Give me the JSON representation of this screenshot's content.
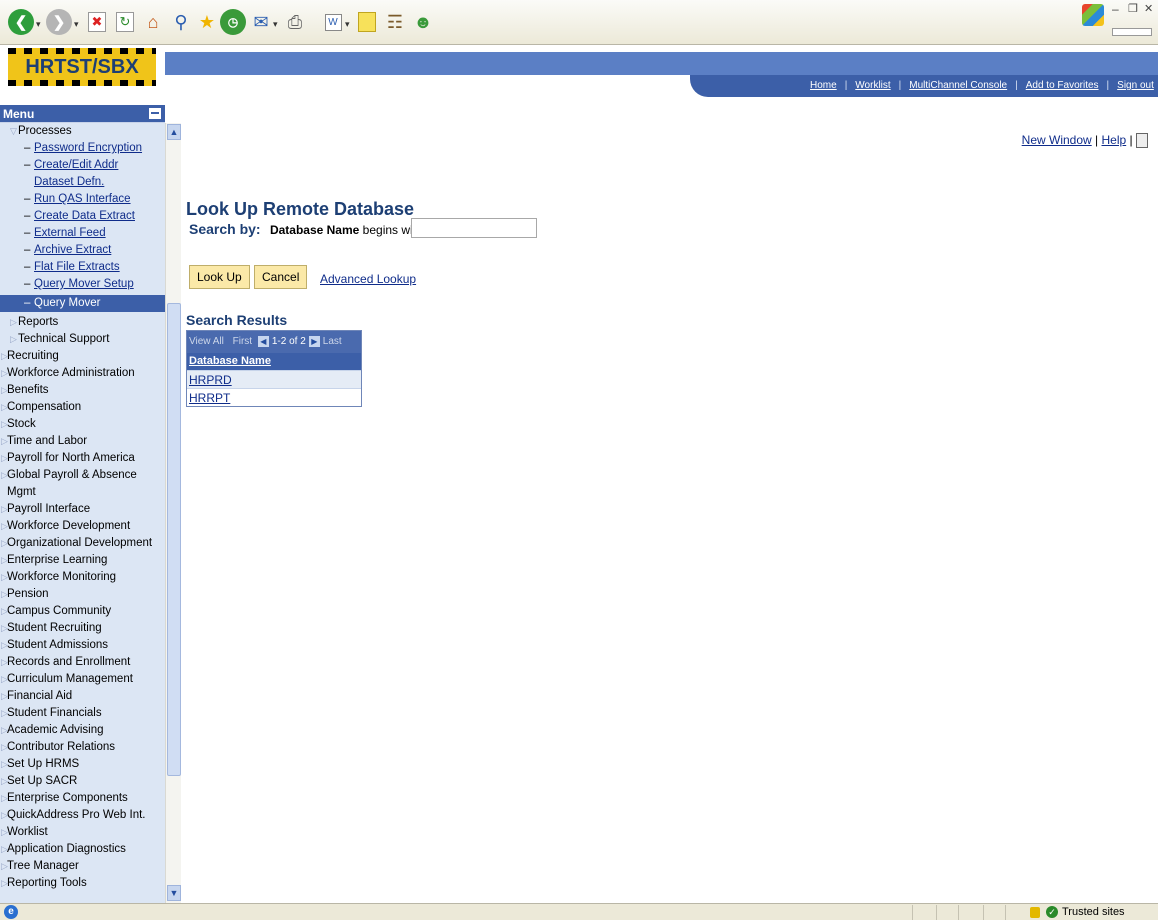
{
  "browser": {
    "toolbar_icons": [
      "back-icon",
      "forward-icon",
      "stop-icon",
      "refresh-icon",
      "home-icon",
      "search-icon",
      "favorites-icon",
      "history-icon",
      "mail-icon",
      "print-icon",
      "word-icon",
      "notes-icon",
      "research-icon",
      "messenger-icon"
    ]
  },
  "logo": {
    "text": "HRTST/SBX"
  },
  "header": {
    "links": [
      "Home",
      "Worklist",
      "MultiChannel Console",
      "Add to Favorites",
      "Sign out"
    ]
  },
  "menu": {
    "title": "Menu",
    "processes": "Processes",
    "process_items": [
      "Password Encryption",
      "Create/Edit Addr",
      "Dataset Defn.",
      "Run QAS Interface",
      "Create Data Extract",
      "External Feed",
      "Archive Extract",
      "Flat File Extracts",
      "Query Mover Setup",
      "Query Mover"
    ],
    "reports": "Reports",
    "technical_support": "Technical Support",
    "top_items": [
      "Recruiting",
      "Workforce Administration",
      "Benefits",
      "Compensation",
      "Stock",
      "Time and Labor",
      "Payroll for North America",
      "Global Payroll & Absence",
      "Mgmt",
      "Payroll Interface",
      "Workforce Development",
      "Organizational Development",
      "Enterprise Learning",
      "Workforce Monitoring",
      "Pension",
      "Campus Community",
      "Student Recruiting",
      "Student Admissions",
      "Records and Enrollment",
      "Curriculum Management",
      "Financial Aid",
      "Student Financials",
      "Academic Advising",
      "Contributor Relations",
      "Set Up HRMS",
      "Set Up SACR",
      "Enterprise Components",
      "QuickAddress Pro Web Int.",
      "Worklist",
      "Application Diagnostics",
      "Tree Manager",
      "Reporting Tools"
    ]
  },
  "utility": {
    "new_window": "New Window",
    "sep": "|",
    "help": "Help"
  },
  "page": {
    "title": "Look Up Remote Database",
    "search_by": "Search by:",
    "field": "Database Name",
    "operator": "begins with",
    "search_value": "",
    "lookup_button": "Look Up",
    "cancel_button": "Cancel",
    "advanced_lookup": "Advanced Lookup",
    "results_title": "Search Results",
    "grid": {
      "view_all": "View All",
      "first": "First",
      "count": "1-2 of 2",
      "last": "Last",
      "column": "Database Name",
      "rows": [
        "HRPRD",
        "HRRPT"
      ]
    }
  },
  "status": {
    "zone": "Trusted sites"
  }
}
